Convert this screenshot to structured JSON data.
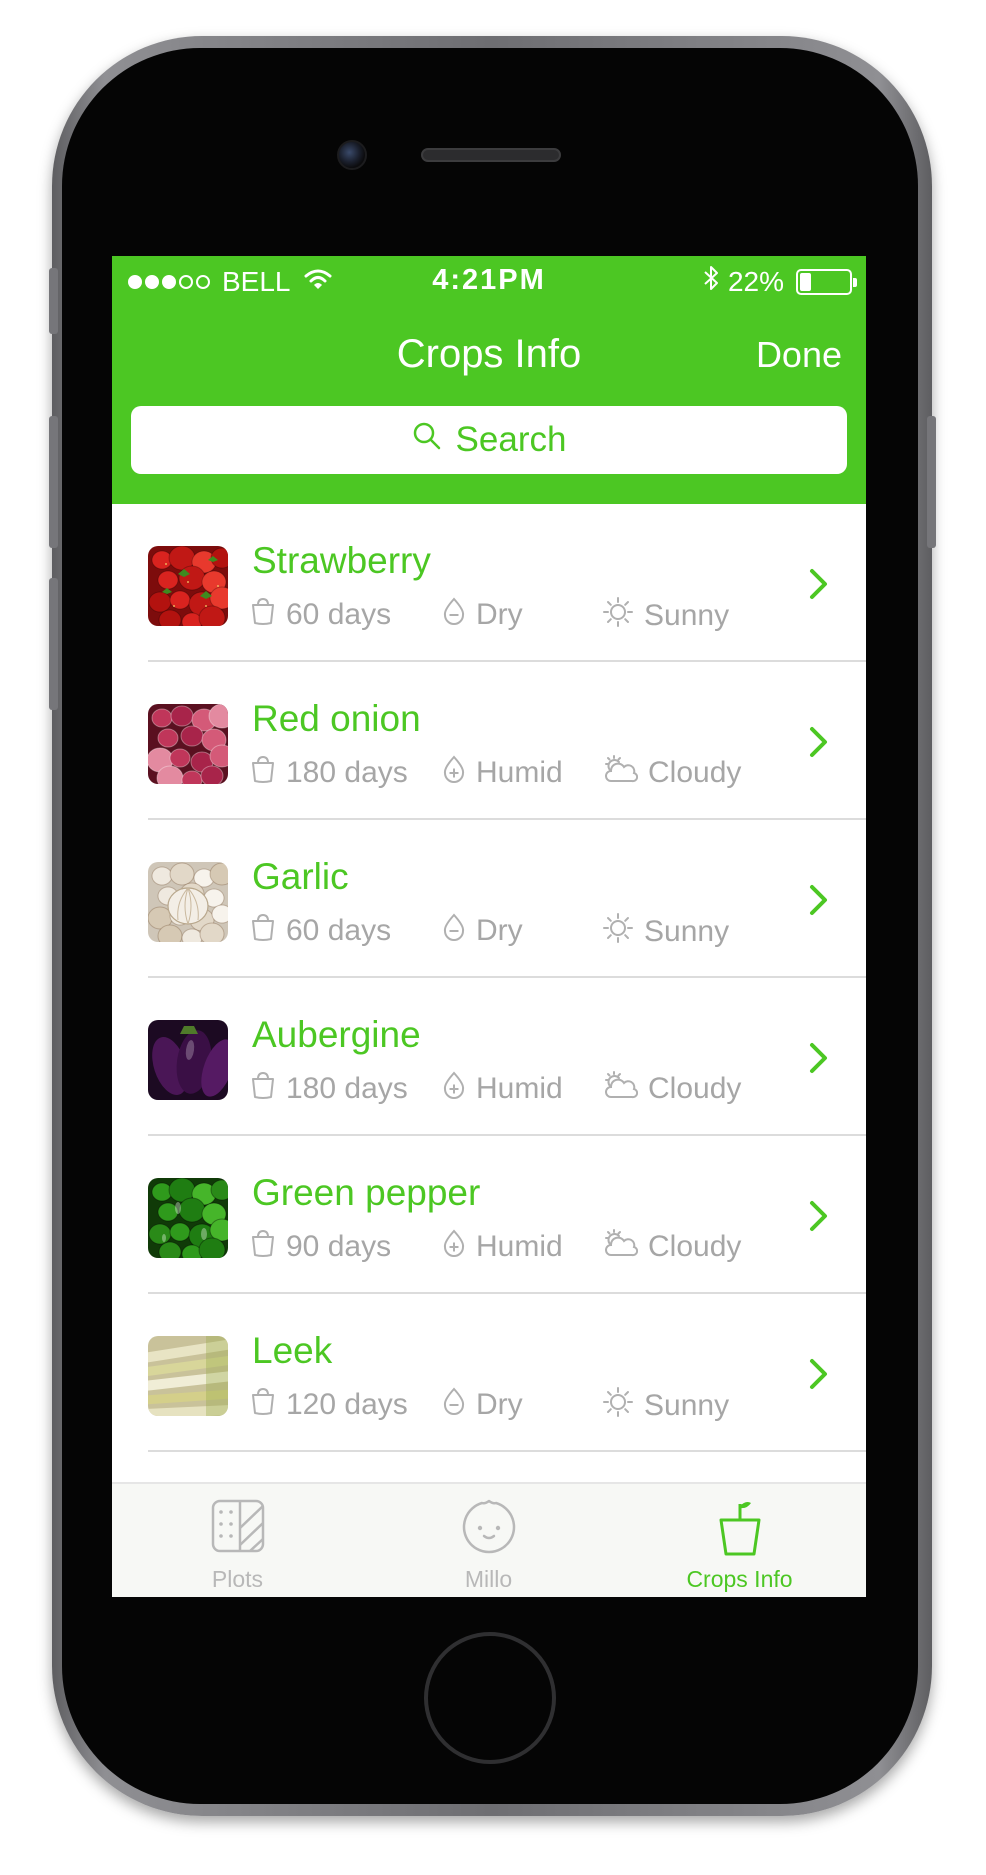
{
  "status_bar": {
    "carrier": "BELL",
    "time": "4:21PM",
    "battery_percent": "22%",
    "battery_level": 0.22,
    "signal_bars_filled": 3,
    "signal_bars_total": 5
  },
  "nav": {
    "title": "Crops Info",
    "done_label": "Done"
  },
  "search": {
    "label": "Search"
  },
  "crops": [
    {
      "name": "Strawberry",
      "days": "60 days",
      "humidity": "Dry",
      "humidity_icon": "dry-drop-icon",
      "weather": "Sunny",
      "weather_icon": "sun-icon",
      "thumb": "strawberry-image"
    },
    {
      "name": "Red onion",
      "days": "180 days",
      "humidity": "Humid",
      "humidity_icon": "humid-drop-icon",
      "weather": "Cloudy",
      "weather_icon": "cloud-icon",
      "thumb": "red-onion-image"
    },
    {
      "name": "Garlic",
      "days": "60 days",
      "humidity": "Dry",
      "humidity_icon": "dry-drop-icon",
      "weather": "Sunny",
      "weather_icon": "sun-icon",
      "thumb": "garlic-image"
    },
    {
      "name": "Aubergine",
      "days": "180 days",
      "humidity": "Humid",
      "humidity_icon": "humid-drop-icon",
      "weather": "Cloudy",
      "weather_icon": "cloud-icon",
      "thumb": "aubergine-image"
    },
    {
      "name": "Green pepper",
      "days": "90 days",
      "humidity": "Humid",
      "humidity_icon": "humid-drop-icon",
      "weather": "Cloudy",
      "weather_icon": "cloud-icon",
      "thumb": "green-pepper-image"
    },
    {
      "name": "Leek",
      "days": "120 days",
      "humidity": "Dry",
      "humidity_icon": "dry-drop-icon",
      "weather": "Sunny",
      "weather_icon": "sun-icon",
      "thumb": "leek-image"
    }
  ],
  "tabs": [
    {
      "label": "Plots",
      "icon": "plots-icon",
      "active": false
    },
    {
      "label": "Millo",
      "icon": "millo-face-icon",
      "active": false
    },
    {
      "label": "Crops Info",
      "icon": "pot-plant-icon",
      "active": true
    }
  ],
  "colors": {
    "accent": "#4cc723",
    "meta_text": "#a6a6a6",
    "tab_inactive": "#b8b8b8"
  }
}
